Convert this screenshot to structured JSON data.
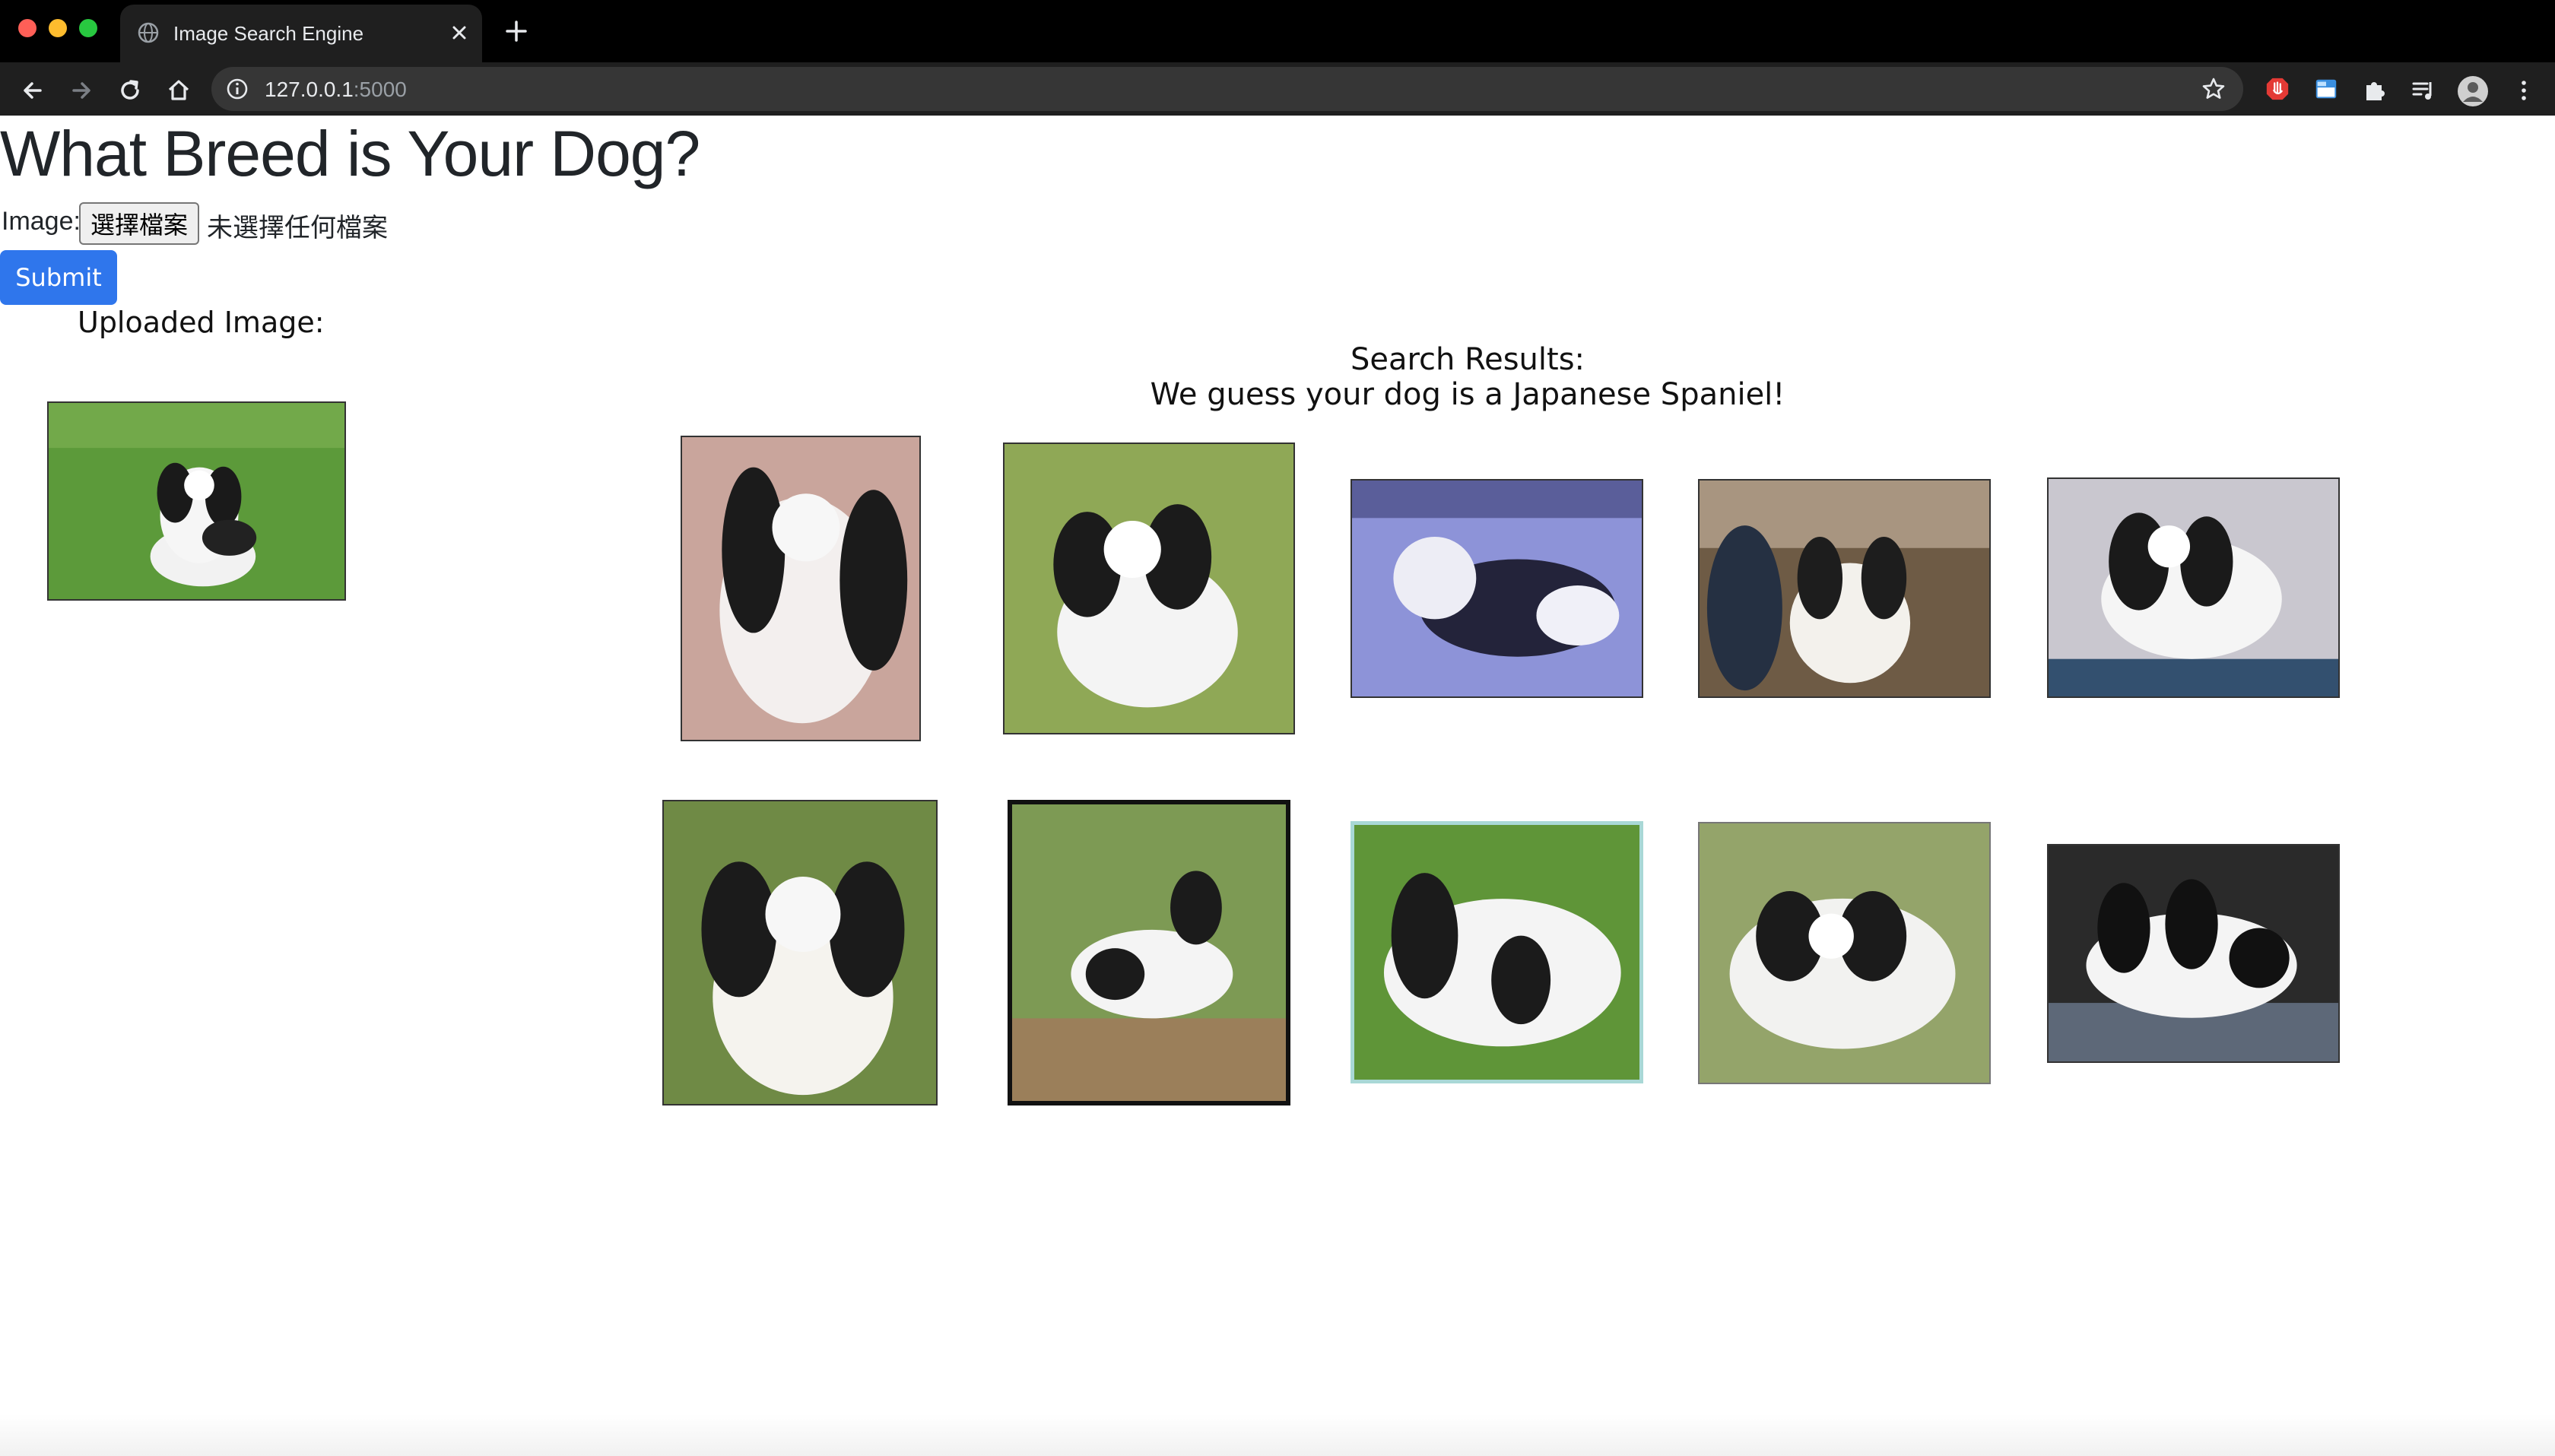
{
  "browser": {
    "tab_title": "Image Search Engine",
    "url_host": "127.0.0.1",
    "url_port": ":5000"
  },
  "page": {
    "title": "What Breed is Your Dog?",
    "image_label": "Image:",
    "file_button": "選擇檔案",
    "file_status": "未選擇任何檔案",
    "submit_label": "Submit",
    "uploaded_label": "Uploaded Image:",
    "results_heading": "Search Results:",
    "results_guess": "We guess your dog is a Japanese Spaniel!"
  },
  "results": [
    {
      "name": "result-1",
      "bg": "#c9a59c"
    },
    {
      "name": "result-2",
      "bg": "#8fa856"
    },
    {
      "name": "result-3",
      "bg": "#8d93d8"
    },
    {
      "name": "result-4",
      "bg": "#6e5b45"
    },
    {
      "name": "result-5",
      "bg": "#c9c7cf"
    },
    {
      "name": "result-6",
      "bg": "#6f8a45"
    },
    {
      "name": "result-7",
      "bg": "#7d9a54"
    },
    {
      "name": "result-8",
      "bg": "#5f9538"
    },
    {
      "name": "result-9",
      "bg": "#94a46a"
    },
    {
      "name": "result-10",
      "bg": "#2a2a2a"
    }
  ],
  "colors": {
    "submit": "#2f76ec",
    "text": "#212529",
    "chrome_dark": "#1f1f1f"
  }
}
